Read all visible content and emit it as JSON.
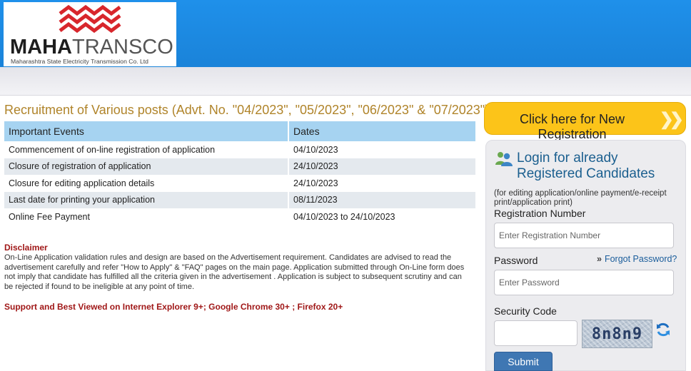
{
  "header": {
    "logo_bold": "MAHA",
    "logo_light": "TRANSCO",
    "logo_subtitle": "Maharashtra State Electricity Transmission Co. Ltd"
  },
  "main": {
    "title": "Recruitment of Various posts (Advt. No. \"04/2023\", \"05/2023\", \"06/2023\" & \"07/2023\")",
    "table": {
      "headers": [
        "Important Events",
        "Dates"
      ],
      "rows": [
        [
          "Commencement of on-line registration of application",
          "04/10/2023"
        ],
        [
          "Closure of registration of application",
          "24/10/2023"
        ],
        [
          "Closure for editing application details",
          "24/10/2023"
        ],
        [
          "Last date for printing your application",
          "08/11/2023"
        ],
        [
          "Online Fee Payment",
          "04/10/2023 to 24/10/2023"
        ]
      ]
    },
    "disclaimer_title": "Disclaimer",
    "disclaimer_text": "On-Line Application validation rules and design are based on the Advertisement requirement. Candidates are advised to read the advertisement carefully and refer \"How to Apply\" & \"FAQ\" pages on the main page. Application submitted through On-Line form does not imply that candidate has fulfilled all the criteria given in the advertisement . Application is subject to subsequent scrutiny and can be rejected if found to be ineligible at any point of time.",
    "support_text": "Support and Best Viewed on Internet Explorer 9+; Google Chrome 30+ ; Firefox 20+"
  },
  "sidebar": {
    "new_registration_label": "Click here for New Registration",
    "login_title": "Login for already Registered Candidates",
    "login_note": "(for editing application/online payment/e-receipt print/application print)",
    "registration_label": "Registration Number",
    "registration_placeholder": "Enter Registration Number",
    "password_label": "Password",
    "password_placeholder": "Enter Password",
    "forgot_password": "Forgot Password?",
    "security_code_label": "Security Code",
    "captcha_text": "8n8n9",
    "submit_label": "Submit"
  },
  "colors": {
    "header_blue": "#1e8be2",
    "title_gold": "#b0842a",
    "cta_yellow": "#fcc419",
    "alert_red": "#a01818",
    "link_blue": "#1a5d9b"
  }
}
